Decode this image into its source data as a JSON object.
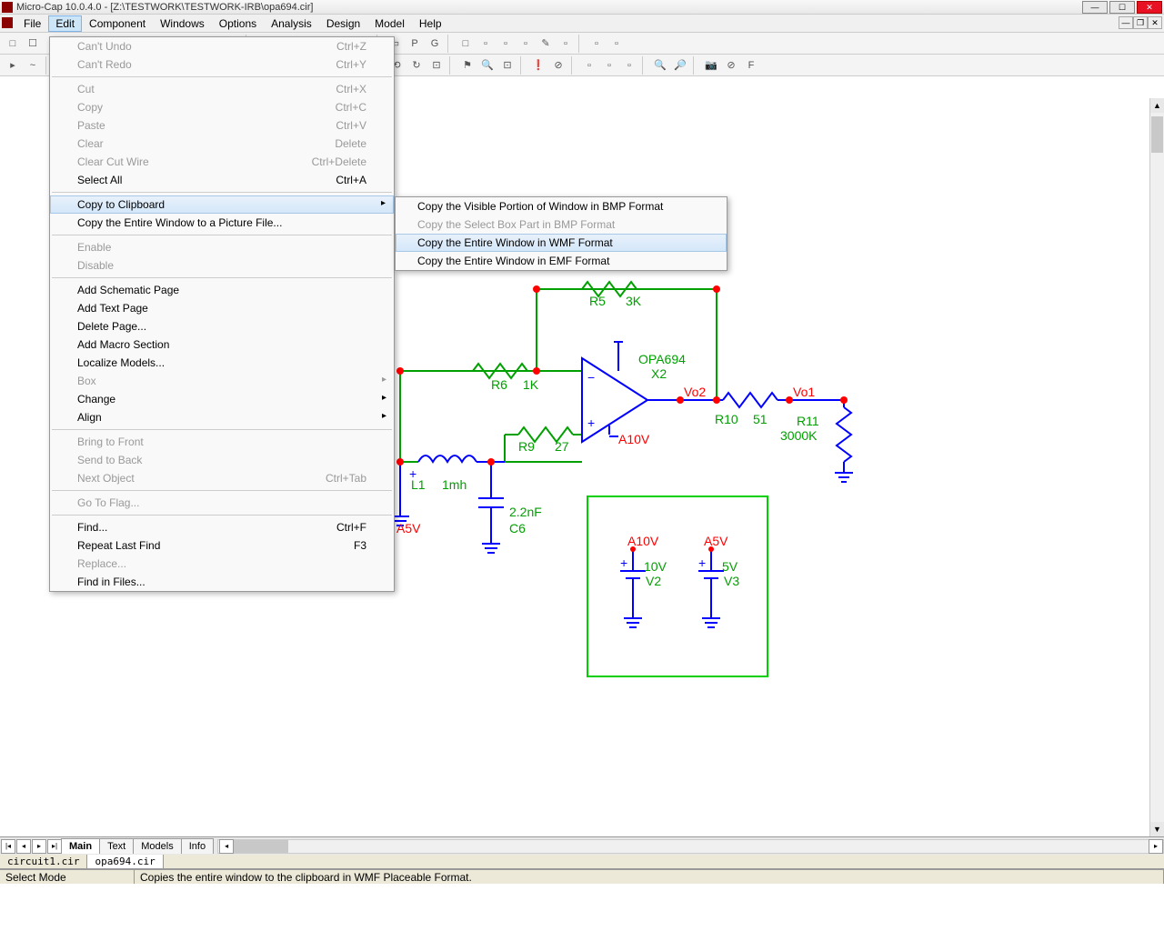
{
  "title": "Micro-Cap 10.0.4.0 - [Z:\\TESTWORK\\TESTWORK-IRB\\opa694.cir]",
  "menubar": [
    "File",
    "Edit",
    "Component",
    "Windows",
    "Options",
    "Analysis",
    "Design",
    "Model",
    "Help"
  ],
  "editmenu": [
    {
      "label": "Can't Undo",
      "sc": "Ctrl+Z",
      "disabled": true
    },
    {
      "label": "Can't Redo",
      "sc": "Ctrl+Y",
      "disabled": true
    },
    {
      "sep": true
    },
    {
      "label": "Cut",
      "sc": "Ctrl+X",
      "disabled": true
    },
    {
      "label": "Copy",
      "sc": "Ctrl+C",
      "disabled": true
    },
    {
      "label": "Paste",
      "sc": "Ctrl+V",
      "disabled": true
    },
    {
      "label": "Clear",
      "sc": "Delete",
      "disabled": true
    },
    {
      "label": "Clear Cut Wire",
      "sc": "Ctrl+Delete",
      "disabled": true
    },
    {
      "label": "Select All",
      "sc": "Ctrl+A"
    },
    {
      "sep": true
    },
    {
      "label": "Copy to Clipboard",
      "arrow": true,
      "hl": true
    },
    {
      "label": "Copy the Entire Window to a Picture File..."
    },
    {
      "sep": true
    },
    {
      "label": "Enable",
      "disabled": true
    },
    {
      "label": "Disable",
      "disabled": true
    },
    {
      "sep": true
    },
    {
      "label": "Add Schematic Page"
    },
    {
      "label": "Add Text Page"
    },
    {
      "label": "Delete Page..."
    },
    {
      "label": "Add Macro Section"
    },
    {
      "label": "Localize Models..."
    },
    {
      "label": "Box",
      "arrow": true,
      "disabled": true
    },
    {
      "label": "Change",
      "arrow": true
    },
    {
      "label": "Align",
      "arrow": true
    },
    {
      "sep": true
    },
    {
      "label": "Bring to Front",
      "disabled": true
    },
    {
      "label": "Send to Back",
      "disabled": true
    },
    {
      "label": "Next Object",
      "sc": "Ctrl+Tab",
      "disabled": true
    },
    {
      "sep": true
    },
    {
      "label": "Go To Flag...",
      "disabled": true
    },
    {
      "sep": true
    },
    {
      "label": "Find...",
      "sc": "Ctrl+F"
    },
    {
      "label": "Repeat Last Find",
      "sc": "F3"
    },
    {
      "label": "Replace...",
      "disabled": true
    },
    {
      "label": "Find in Files..."
    }
  ],
  "submenu": [
    {
      "label": "Copy the Visible Portion of Window in BMP Format"
    },
    {
      "label": "Copy the Select Box Part in BMP Format",
      "disabled": true
    },
    {
      "label": "Copy the Entire Window in WMF Format",
      "hl": true
    },
    {
      "label": "Copy the Entire Window in EMF Format"
    }
  ],
  "sheettabs": {
    "items": [
      "Main",
      "Text",
      "Models",
      "Info"
    ],
    "active": 0
  },
  "filetabs": {
    "items": [
      "circuit1.cir",
      "opa694.cir"
    ],
    "active": 1
  },
  "status": {
    "mode": "Select Mode",
    "msg": "Copies the entire window to the clipboard in WMF Placeable Format."
  },
  "toolbar1": [
    "□",
    "☐",
    "□",
    "+",
    "↕",
    "⊥",
    "⊕",
    "T",
    "~",
    "▭",
    "◇",
    "□",
    "|",
    "▦",
    "▥",
    "▤",
    "▣",
    "▢",
    "▦",
    "|",
    "▭",
    "P",
    "G",
    "|",
    "□",
    "▫",
    "▫",
    "▫",
    "✎",
    "▫",
    "|",
    "▫",
    "▫"
  ],
  "toolbar2": [
    "▸",
    "~",
    "|",
    "↶",
    "↷",
    "|",
    "✂",
    "⧉",
    "📋",
    "|",
    "≡",
    "⟂",
    "—",
    "⊞",
    "▾",
    "⊡",
    "↖",
    "⊞",
    "|",
    "⊡",
    "↔",
    "⟲",
    "↻",
    "⊡",
    "|",
    "⚑",
    "🔍",
    "⊡",
    "|",
    "❗",
    "⊘",
    "|",
    "▫",
    "▫",
    "▫",
    "|",
    "🔍",
    "🔎",
    "|",
    "📷",
    "⊘",
    "F"
  ],
  "circuit": {
    "labels": {
      "r5": "R5",
      "r5v": "3K",
      "r6": "R6",
      "r6v": "1K",
      "r9": "R9",
      "r9v": "27",
      "r10": "R10",
      "r10v": "51",
      "r11": "R11",
      "r11v": "3000K",
      "l1": "L1",
      "l1v": "1mh",
      "c6": "C6",
      "c6v": "2.2nF",
      "opa": "OPA694",
      "x2": "X2",
      "vo1": "Vo1",
      "vo2": "Vo2",
      "a10v": "A10V",
      "a5v": "A5V",
      "v2": "V2",
      "v2v": "10V",
      "v3": "V3",
      "v3v": "5V"
    }
  }
}
